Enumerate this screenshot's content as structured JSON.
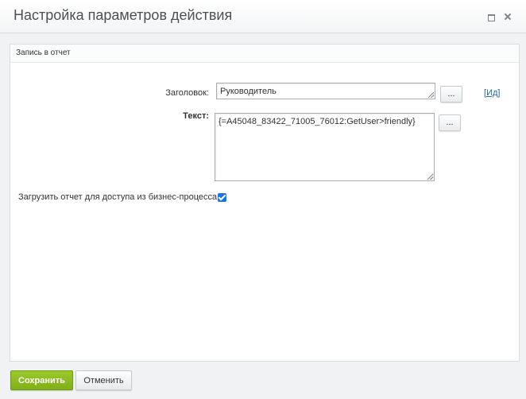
{
  "dialog": {
    "title": "Настройка параметров действия",
    "maximize_icon": "maximize-icon",
    "close_icon": "close-icon"
  },
  "section": {
    "title": "Запись в отчет"
  },
  "form": {
    "title_label": "Заголовок:",
    "title_value": "Руководитель",
    "text_label": "Текст:",
    "text_value": "{=A45048_83422_71005_76012:GetUser>friendly}",
    "dots_label": "...",
    "id_link_open": "[",
    "id_link_text": "Ид",
    "id_link_close": "]",
    "upload_label": "Загрузить отчет для доступа из бизнес-процесса:",
    "upload_checked": true
  },
  "footer": {
    "save_label": "Сохранить",
    "cancel_label": "Отменить"
  },
  "colors": {
    "accent_green": "#8cbd1f",
    "link_blue": "#2067b0",
    "checkbox_blue": "#1a73e8"
  }
}
